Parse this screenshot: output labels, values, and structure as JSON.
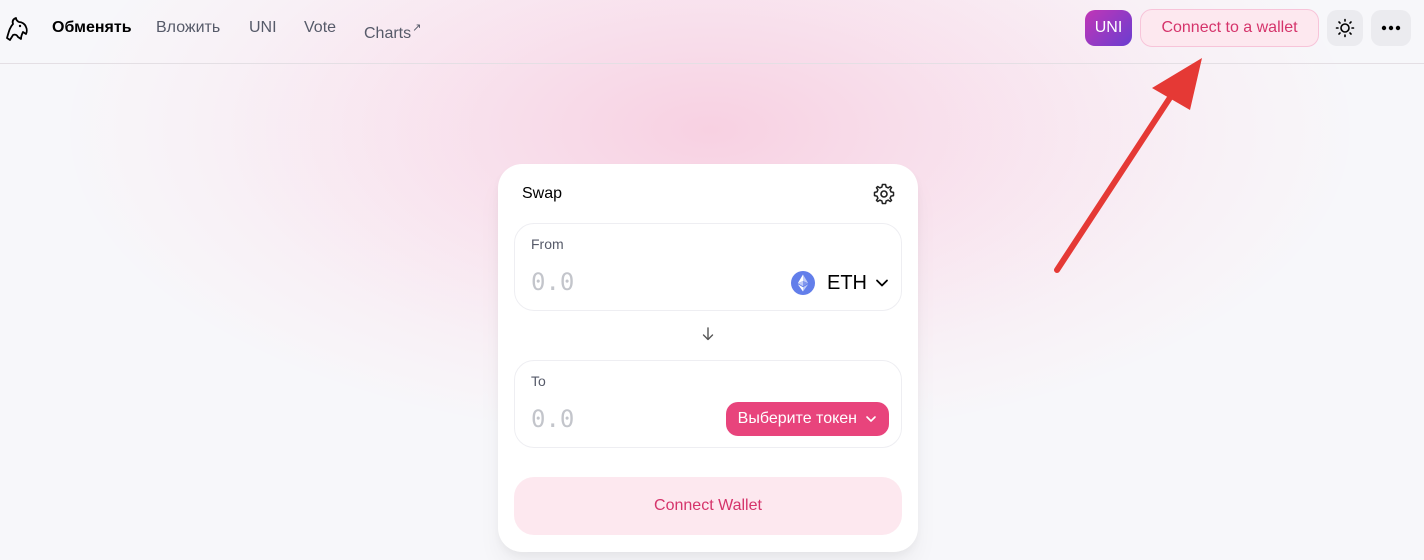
{
  "nav": {
    "logo_icon": "unicorn-logo-icon",
    "items": [
      {
        "label": "Обменять",
        "active": true
      },
      {
        "label": "Вложить"
      },
      {
        "label": "UNI"
      },
      {
        "label": "Vote"
      },
      {
        "label": "Charts",
        "suffix": "↗"
      }
    ]
  },
  "header_right": {
    "uni_badge": "UNI",
    "connect_label": "Connect to a wallet",
    "theme_icon": "sun-icon",
    "more_icon": "more-dots-icon"
  },
  "swap": {
    "title": "Swap",
    "settings_icon": "gear-icon",
    "from": {
      "label": "From",
      "placeholder": "0.0",
      "token": "ETH",
      "token_icon": "ethereum-icon"
    },
    "switch_icon": "arrow-down-icon",
    "to": {
      "label": "To",
      "placeholder": "0.0",
      "select_label": "Выберите токен"
    },
    "connect_label": "Connect Wallet"
  },
  "colors": {
    "accent_pink": "#e8447c",
    "connect_text": "#d5346b",
    "connect_bg": "#fde8ef",
    "annotation_arrow": "#e53935"
  }
}
